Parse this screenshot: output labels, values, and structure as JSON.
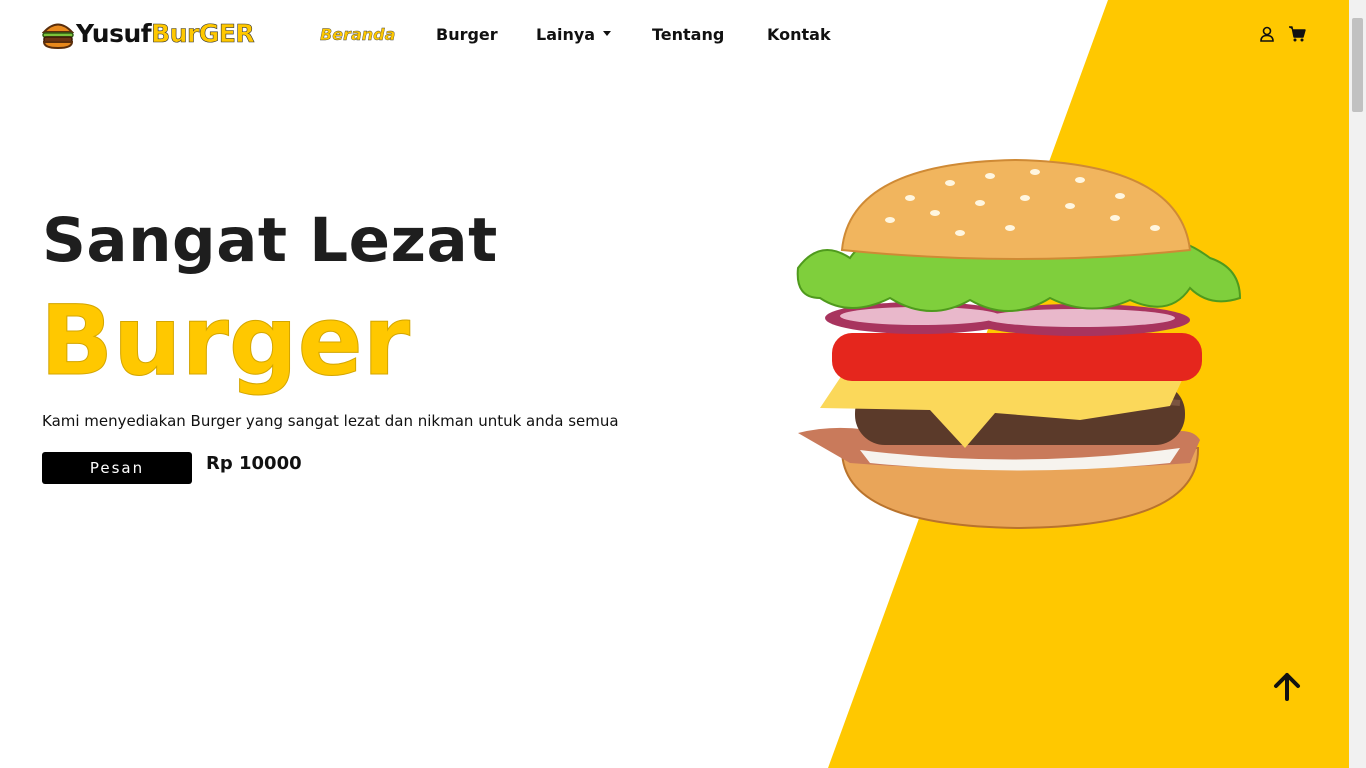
{
  "brand": {
    "part1": "Yusuf",
    "part2": "BurGER"
  },
  "nav": {
    "items": [
      {
        "label": "Beranda",
        "active": true
      },
      {
        "label": "Burger"
      },
      {
        "label": "Lainya"
      },
      {
        "label": "Tentang"
      },
      {
        "label": "Kontak"
      }
    ],
    "icons": [
      "user-icon",
      "cart-icon"
    ]
  },
  "hero": {
    "title": "Sangat Lezat",
    "subtitle": "Burger",
    "description": "Kami menyediakan Burger yang sangat lezat dan nikman untuk anda semua",
    "button_label": "Pesan",
    "price": "Rp 10000"
  },
  "colors": {
    "accent": "#ffc800",
    "text": "#1e1e1e",
    "button": "#000000"
  }
}
